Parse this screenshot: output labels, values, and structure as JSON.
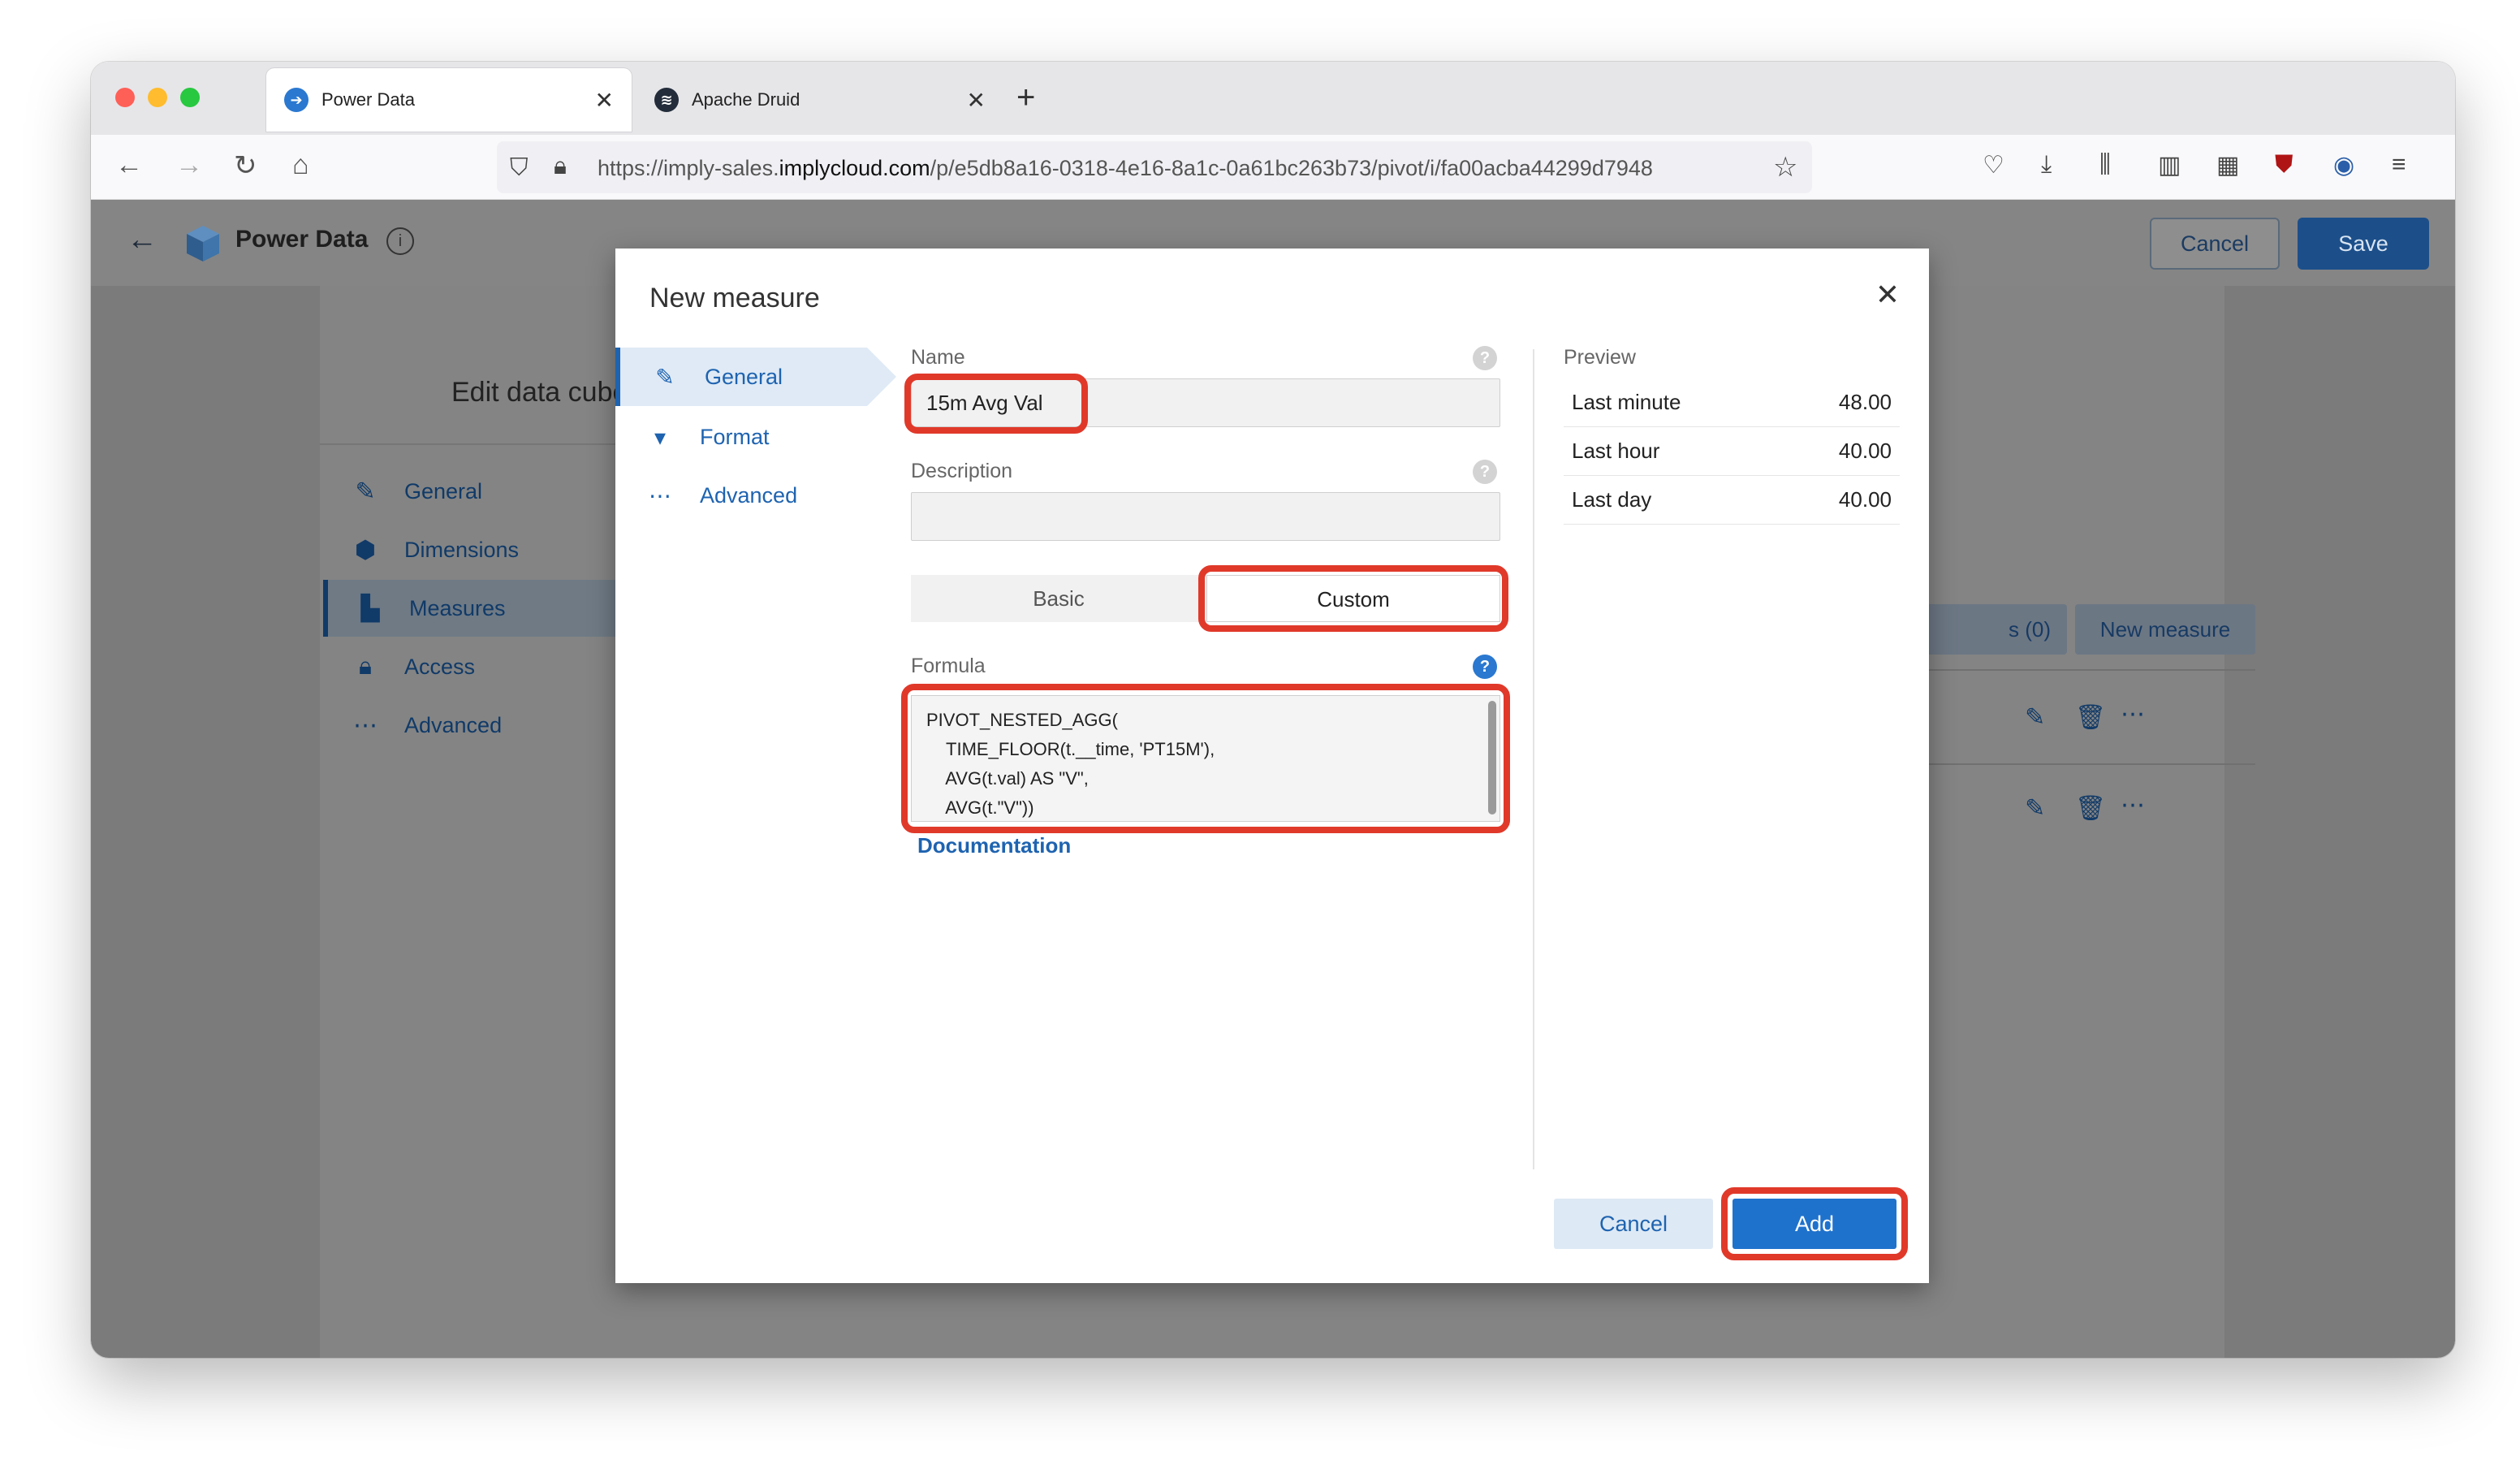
{
  "browser": {
    "tabs": [
      {
        "label": "Power Data",
        "active": true
      },
      {
        "label": "Apache Druid",
        "active": false
      }
    ],
    "new_tab": "+",
    "close_glyph": "✕",
    "url_prefix": "https://imply-sales.",
    "url_domain": "implycloud.com",
    "url_path": "/p/e5db8a16-0318-4e16-8a1c-0a61bc263b73/pivot/i/fa00acba44299d7948"
  },
  "app": {
    "title": "Power Data",
    "info_glyph": "i",
    "cancel_label": "Cancel",
    "save_label": "Save",
    "panel_title": "Edit data cube",
    "nav": [
      {
        "label": "General",
        "icon": "edit-icon"
      },
      {
        "label": "Dimensions",
        "icon": "cube-icon"
      },
      {
        "label": "Measures",
        "icon": "bar-chart-icon",
        "selected": true
      },
      {
        "label": "Access",
        "icon": "lock-icon"
      },
      {
        "label": "Advanced",
        "icon": "more-icon"
      }
    ],
    "toolbar_partial": "s (0)",
    "new_measure_label": "New measure"
  },
  "modal": {
    "title": "New measure",
    "close_glyph": "✕",
    "tabs": [
      {
        "label": "General",
        "selected": true
      },
      {
        "label": "Format"
      },
      {
        "label": "Advanced"
      }
    ],
    "name_label": "Name",
    "name_value": "15m Avg Val",
    "description_label": "Description",
    "description_value": "",
    "mode_basic": "Basic",
    "mode_custom": "Custom",
    "formula_label": "Formula",
    "formula_lines": [
      "PIVOT_NESTED_AGG(",
      "    TIME_FLOOR(t.__time, 'PT15M'),",
      "    AVG(t.val) AS \"V\",",
      "    AVG(t.\"V\"))"
    ],
    "documentation_link": "Documentation",
    "preview_title": "Preview",
    "preview_rows": [
      {
        "label": "Last minute",
        "value": "48.00"
      },
      {
        "label": "Last hour",
        "value": "40.00"
      },
      {
        "label": "Last day",
        "value": "40.00"
      }
    ],
    "cancel_label": "Cancel",
    "add_label": "Add"
  },
  "colors": {
    "accent": "#1f72cc",
    "highlight": "#e0392a"
  }
}
